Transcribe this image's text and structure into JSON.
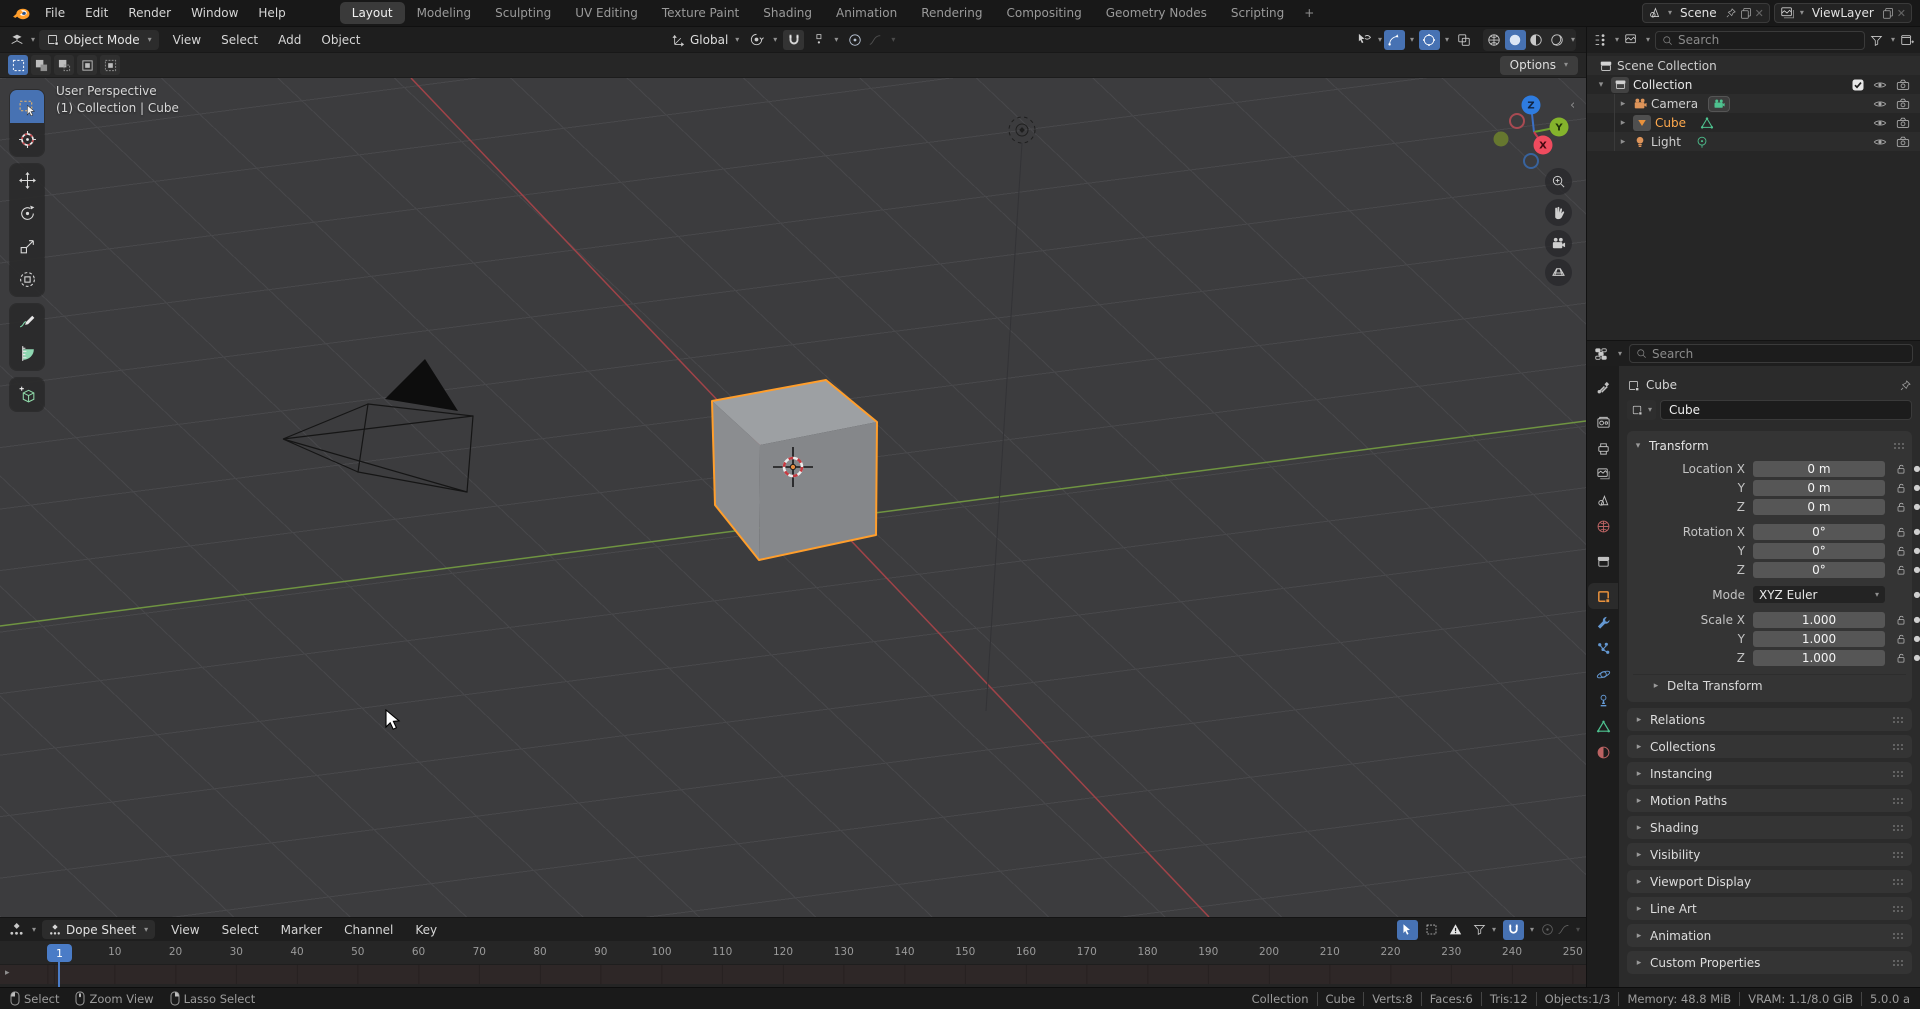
{
  "topbar": {
    "menus": [
      "File",
      "Edit",
      "Render",
      "Window",
      "Help"
    ],
    "tabs": [
      "Layout",
      "Modeling",
      "Sculpting",
      "UV Editing",
      "Texture Paint",
      "Shading",
      "Animation",
      "Rendering",
      "Compositing",
      "Geometry Nodes",
      "Scripting"
    ],
    "add_tab": "+",
    "scene": {
      "label": "Scene"
    },
    "view_layer": {
      "label": "ViewLayer"
    }
  },
  "viewport_header": {
    "mode": "Object Mode",
    "menus": [
      "View",
      "Select",
      "Add",
      "Object"
    ],
    "orientation": "Global"
  },
  "tool_settings": {
    "options": "Options"
  },
  "viewport": {
    "view_label": "User Perspective",
    "context_label": "(1) Collection | Cube",
    "axis_labels": {
      "x": "X",
      "y": "Y",
      "z": "Z"
    }
  },
  "outliner": {
    "search_placeholder": "Search",
    "scene_collection": "Scene Collection",
    "collection": "Collection",
    "objects": {
      "camera": "Camera",
      "cube": "Cube",
      "light": "Light"
    }
  },
  "properties": {
    "search_placeholder": "Search",
    "breadcrumb": "Cube",
    "name_value": "Cube",
    "transform_title": "Transform",
    "rows": [
      {
        "label": "Location X",
        "value": "0 m"
      },
      {
        "label": "Y",
        "value": "0 m"
      },
      {
        "label": "Z",
        "value": "0 m"
      },
      {
        "label": "Rotation X",
        "value": "0°"
      },
      {
        "label": "Y",
        "value": "0°"
      },
      {
        "label": "Z",
        "value": "0°"
      },
      {
        "label": "Scale X",
        "value": "1.000"
      },
      {
        "label": "Y",
        "value": "1.000"
      },
      {
        "label": "Z",
        "value": "1.000"
      }
    ],
    "mode_label": "Mode",
    "mode_value": "XYZ Euler",
    "delta_transform": "Delta Transform",
    "sections": [
      "Relations",
      "Collections",
      "Instancing",
      "Motion Paths",
      "Shading",
      "Visibility",
      "Viewport Display",
      "Line Art",
      "Animation",
      "Custom Properties"
    ]
  },
  "timeline": {
    "editor": "Dope Sheet",
    "menus": [
      "View",
      "Select",
      "Marker",
      "Channel",
      "Key"
    ],
    "current_frame": "1",
    "ticks": [
      "10",
      "20",
      "30",
      "40",
      "50",
      "60",
      "70",
      "80",
      "90",
      "100",
      "110",
      "120",
      "130",
      "140",
      "150",
      "160",
      "170",
      "180",
      "190",
      "200",
      "210",
      "220",
      "230",
      "240",
      "250"
    ]
  },
  "status_bar": {
    "hints": [
      "Select",
      "Zoom View",
      "Lasso Select"
    ],
    "stats": [
      "Collection",
      "Cube",
      "Verts:8",
      "Faces:6",
      "Tris:12",
      "Objects:1/3",
      "Memory: 48.8 MiB",
      "VRAM: 1.1/8.0 GiB",
      "5.0.0 a"
    ]
  },
  "colors": {
    "accent_blue": "#4772b3",
    "selection_orange": "#ff9e2c",
    "axis_x_red": "#a04348",
    "axis_y_green": "#6f9441"
  }
}
